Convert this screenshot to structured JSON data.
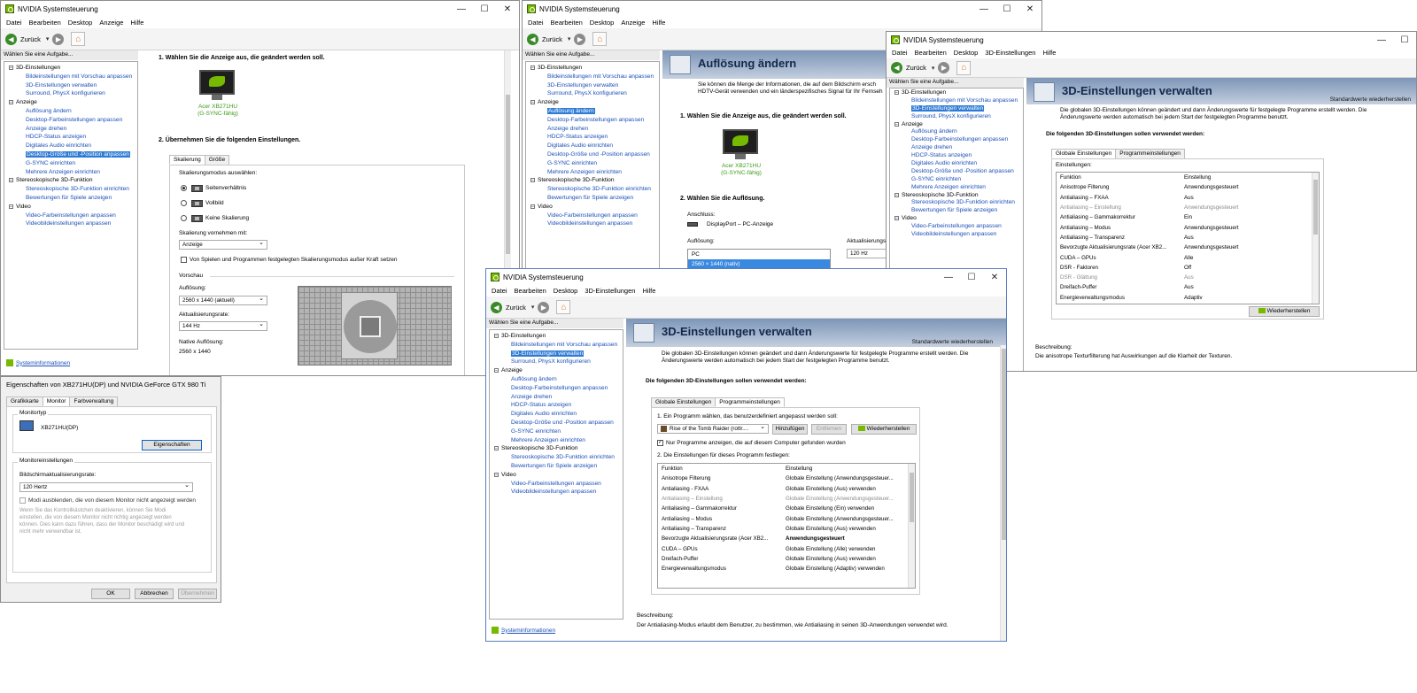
{
  "app": {
    "title": "NVIDIA Systemsteuerung",
    "back": "Zurück",
    "task_header": "Wählen Sie eine Aufgabe...",
    "task_header_partial": "Wählen Sie eine Aufgabe...",
    "sysinfo": "Systeminformationen",
    "menu_basic": [
      "Datei",
      "Bearbeiten",
      "Desktop",
      "Anzeige",
      "Hilfe"
    ],
    "menu_3d": [
      "Datei",
      "Bearbeiten",
      "Desktop",
      "3D-Einstellungen",
      "Hilfe"
    ],
    "controls": {
      "min": "—",
      "max": "☐",
      "close": "✕"
    }
  },
  "tree": {
    "cat_3d": "3D-Einstellungen",
    "item_3d_preview": "Bildeinstellungen mit Vorschau anpassen",
    "item_3d_manage": "3D-Einstellungen verwalten",
    "item_3d_physx": "Surround, PhysX konfigurieren",
    "cat_display": "Anzeige",
    "item_res": "Auflösung ändern",
    "item_color": "Desktop-Farbeinstellungen anpassen",
    "item_rotate": "Anzeige drehen",
    "item_hdcp": "HDCP-Status anzeigen",
    "item_audio": "Digitales Audio einrichten",
    "item_size": "Desktop-Größe und -Position anpassen",
    "item_gsync": "G-SYNC einrichten",
    "item_multi": "Mehrere Anzeigen einrichten",
    "cat_stereo": "Stereoskopische 3D-Funktion",
    "item_stereo": "Stereoskopische 3D-Funktion einrichten",
    "item_ratings": "Bewertungen für Spiele anzeigen",
    "cat_video": "Video",
    "item_vcolor": "Video-Farbeinstellungen anpassen",
    "item_vimage": "Videobildeinstellungen anpassen"
  },
  "win_size": {
    "step1": "1. Wählen Sie die Anzeige aus, die geändert werden soll.",
    "monitor_name": "Acer XB271HU",
    "monitor_gsync": "(G-SYNC-fähig)",
    "step2": "2. Übernehmen Sie die folgenden Einstellungen.",
    "tab_scaling": "Skalierung",
    "tab_size": "Größe",
    "mode_label": "Skalierungsmodus auswählen:",
    "mode_aspect": "Seitenverhältnis",
    "mode_full": "Vollbild",
    "mode_none": "Keine Skalierung",
    "perform_label": "Skalierung vornehmen mit:",
    "perform_value": "Anzeige",
    "override_label": "Von Spielen und Programmen festgelegten Skalierungsmodus außer Kraft setzen",
    "preview_label": "Vorschau",
    "res_label": "Auflösung:",
    "res_value": "2560 x 1440 (aktuell)",
    "rate_label": "Aktualisierungsrate:",
    "rate_value": "144 Hz",
    "native_label": "Native Auflösung:",
    "native_value": "2560 x 1440"
  },
  "win_res": {
    "title": "Auflösung ändern",
    "intro1": "Sie können die Menge der Informationen, die auf dem Bildschirm ersch",
    "intro2": "HDTV-Gerät verwenden und ein länderspezifisches Signal für Ihr Fernseh",
    "step1": "1. Wählen Sie die Anzeige aus, die geändert werden soll.",
    "monitor_name": "Acer XB271HU",
    "monitor_gsync": "(G-SYNC-fähig)",
    "step2": "2. Wählen Sie die Auflösung.",
    "conn_label": "Anschluss:",
    "conn_value": "DisplayPort – PC-Anzeige",
    "res_label": "Auflösung:",
    "rate_label": "Aktualisierungs",
    "list_group": "PC",
    "list_sel": "2560 × 1440 (nativ)",
    "rate_value": "120 Hz"
  },
  "win_3d_global": {
    "title": "3D-Einstellungen verwalten",
    "restore": "Standardwerte wiederherstellen",
    "intro1": "Die globalen 3D-Einstellungen können geändert und dann Änderungswerte für festgelegte Programme erstellt werden. Die",
    "intro2": "Änderungswerte werden automatisch bei jedem Start der festgelegten Programme benutzt.",
    "section": "Die folgenden 3D-Einstellungen sollen verwendet werden:",
    "tab_global": "Globale Einstellungen",
    "tab_program": "Programmeinstellungen",
    "settings_label": "Einstellungen:",
    "col_func": "Funktion",
    "col_setting": "Einstellung",
    "rows": [
      {
        "f": "Anisotrope Filterung",
        "s": "Anwendungsgesteuert"
      },
      {
        "f": "Antialiasing – FXAA",
        "s": "Aus"
      },
      {
        "f": "Antialiasing – Einstellung",
        "s": "Anwendungsgesteuert",
        "dim": true
      },
      {
        "f": "Antialiasing – Gammakorrektur",
        "s": "Ein"
      },
      {
        "f": "Antialiasing – Modus",
        "s": "Anwendungsgesteuert"
      },
      {
        "f": "Antialiasing – Transparenz",
        "s": "Aus"
      },
      {
        "f": "Bevorzugte Aktualisierungsrate (Acer XB2...",
        "s": "Anwendungsgesteuert"
      },
      {
        "f": "CUDA – GPUs",
        "s": "Alle"
      },
      {
        "f": "DSR - Faktoren",
        "s": "Off"
      },
      {
        "f": "DSR - Glättung",
        "s": "Aus",
        "dim": true
      },
      {
        "f": "Dreifach-Puffer",
        "s": "Aus"
      },
      {
        "f": "Energieverwaltungsmodus",
        "s": "Adaptiv"
      }
    ],
    "restore_btn": "Wiederherstellen",
    "desc_label": "Beschreibung:",
    "desc_text": "Die anisotrope Texturfilterung hat Auswirkungen auf die Klarheit der Texturen."
  },
  "win_3d_program": {
    "title": "3D-Einstellungen verwalten",
    "restore": "Standardwerte wiederherstellen",
    "intro1": "Die globalen 3D-Einstellungen können geändert und dann Änderungswerte für festgelegte Programme erstellt werden. Die",
    "intro2": "Änderungswerte werden automatisch bei jedem Start der festgelegten Programme benutzt.",
    "section": "Die folgenden 3D-Einstellungen sollen verwendet werden:",
    "tab_global": "Globale Einstellungen",
    "tab_program": "Programmeinstellungen",
    "step1": "1. Ein Programm wählen, das benutzerdefiniert angepasst werden soll:",
    "program_value": "Rise of the Tomb Raider (rottr....",
    "add_btn": "Hinzufügen",
    "remove_btn": "Entfernen",
    "restore_btn": "Wiederherstellen",
    "only_found": "Nur Programme anzeigen, die auf diesem Computer gefunden wurden",
    "step2": "2. Die Einstellungen für dieses Programm festlegen:",
    "col_func": "Funktion",
    "col_setting": "Einstellung",
    "rows": [
      {
        "f": "Anisotrope Filterung",
        "s": "Globale Einstellung (Anwendungsgesteuer..."
      },
      {
        "f": "Antialiasing - FXAA",
        "s": "Globale Einstellung (Aus) verwenden"
      },
      {
        "f": "Antialiasing – Einstellung",
        "s": "Globale Einstellung (Anwendungsgesteuer...",
        "dim": true
      },
      {
        "f": "Antialiasing – Gammakorrektur",
        "s": "Globale Einstellung (Ein) verwenden"
      },
      {
        "f": "Antialiasing – Modus",
        "s": "Globale Einstellung (Anwendungsgesteuer..."
      },
      {
        "f": "Antialiasing – Transparenz",
        "s": "Globale Einstellung (Aus) verwenden"
      },
      {
        "f": "Bevorzugte Aktualisierungsrate (Acer XB2...",
        "s": "Anwendungsgesteuert",
        "bold": true
      },
      {
        "f": "CUDA – GPUs",
        "s": "Globale Einstellung (Alle) verwenden"
      },
      {
        "f": "Dreifach-Puffer",
        "s": "Globale Einstellung (Aus) verwenden"
      },
      {
        "f": "Energieverwaltungsmodus",
        "s": "Globale Einstellung (Adaptiv) verwenden"
      }
    ],
    "desc_label": "Beschreibung:",
    "desc_text": "Der Antialiasing-Modus erlaubt dem Benutzer, zu bestimmen, wie Antialiasing in seinen 3D-Anwendungen verwendet wird."
  },
  "props": {
    "title": "Eigenschaften von XB271HU(DP) und NVIDIA GeForce GTX 980 Ti",
    "tab_adapter": "Grafikkarte",
    "tab_monitor": "Monitor",
    "tab_color": "Farbverwaltung",
    "type_group": "Monitortyp",
    "monitor": "XB271HU(DP)",
    "props_btn": "Eigenschaften",
    "settings_group": "Monitoreinstellungen",
    "rate_label": "Bildschirmaktualisierungsrate:",
    "rate_value": "120 Hertz",
    "hide_modes": "Modi ausblenden, die von diesem Monitor nicht angezeigt werden",
    "warn1": "Wenn Sie das Kontrollkästchen deaktivieren, können Sie Modi",
    "warn2": "einstellen, die von diesem Monitor nicht richtig angezeigt werden",
    "warn3": "können. Dies kann dazu führen, dass der Monitor beschädigt wird und",
    "warn4": "nicht mehr verwendbar ist.",
    "ok": "OK",
    "cancel": "Abbrechen",
    "apply": "Übernehmen"
  },
  "colors": {
    "nvidia_green": "#76b900",
    "selection": "#2e7bd6",
    "link": "#1a4fb8"
  }
}
